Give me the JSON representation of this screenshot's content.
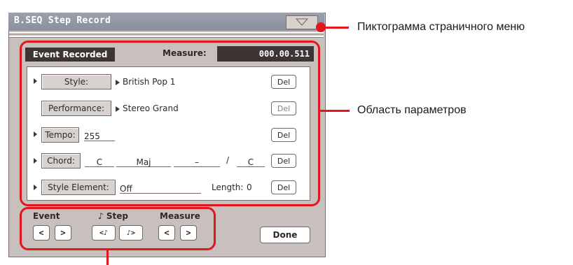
{
  "window": {
    "title": "B.SEQ Step Record"
  },
  "header": {
    "event_recorded": "Event Recorded",
    "measure_label": "Measure:",
    "measure_value": "000.00.511"
  },
  "params": {
    "style": {
      "label": "Style:",
      "value": "British Pop 1",
      "del": "Del"
    },
    "performance": {
      "label": "Performance:",
      "value": "Stereo Grand",
      "del": "Del"
    },
    "tempo": {
      "label": "Tempo:",
      "value": "255",
      "del": "Del"
    },
    "chord": {
      "label": "Chord:",
      "root": "C",
      "type": "Maj",
      "tension": "–",
      "slash": "/",
      "bass": "C",
      "del": "Del"
    },
    "style_element": {
      "label": "Style Element:",
      "value": "Off",
      "length_label": "Length:",
      "length_value": "0",
      "del": "Del"
    }
  },
  "nav": {
    "event_label": "Event",
    "step_label": "♪ Step",
    "measure_label": "Measure",
    "prev": "<",
    "next": ">",
    "step_prev": "<♪",
    "step_next": "♪>",
    "done": "Done"
  },
  "annotations": {
    "menu_icon": "Пиктограмма страничного меню",
    "param_area": "Область параметров"
  },
  "colors": {
    "callout": "#e2161f",
    "titlebar": "#9aa0ad",
    "panel": "#c8c0bc",
    "dark_field": "#3d3535"
  }
}
